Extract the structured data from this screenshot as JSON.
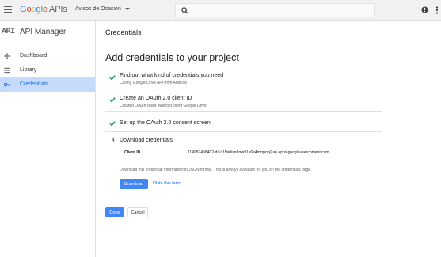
{
  "topbar": {
    "logo_google": "Google",
    "logo_apis": "APIs",
    "project_name": "Avisos de Ocasión",
    "search_placeholder": ""
  },
  "sidebar": {
    "api_mark": "API",
    "title": "API Manager",
    "items": [
      {
        "label": "Dashboard",
        "icon": "dashboard-icon",
        "active": false
      },
      {
        "label": "Library",
        "icon": "library-icon",
        "active": false
      },
      {
        "label": "Credentials",
        "icon": "key-icon",
        "active": true
      }
    ]
  },
  "main": {
    "header_title": "Credentials",
    "page_title": "Add credentials to your project",
    "steps": [
      {
        "title": "Find out what kind of credentials you need",
        "subtitle": "Calling Google Drive API from Android",
        "status": "done"
      },
      {
        "title": "Create an OAuth 2.0 client ID",
        "subtitle": "Created OAuth client 'Android client Google Drive'",
        "status": "done"
      },
      {
        "title": "Set up the OAuth 2.0 consent screen",
        "subtitle": "",
        "status": "done"
      },
      {
        "number": "4",
        "title": "Download credentials",
        "status": "current"
      }
    ],
    "client_id_label": "Client ID",
    "client_id_value": "114987458402-di1o1ffa0isn8me91s6e4mrrpnbj2an.apps.googleusercontent.com",
    "download_note": "Download this credential information in JSON format. This is always available for you on the credentials page.",
    "download_button": "Download",
    "later_link": "I'll do this later",
    "done_button": "Done",
    "cancel_button": "Cancel"
  },
  "colors": {
    "accent": "#4285f4",
    "check": "#0f9d58",
    "active_nav_bg": "#c6dafc"
  }
}
